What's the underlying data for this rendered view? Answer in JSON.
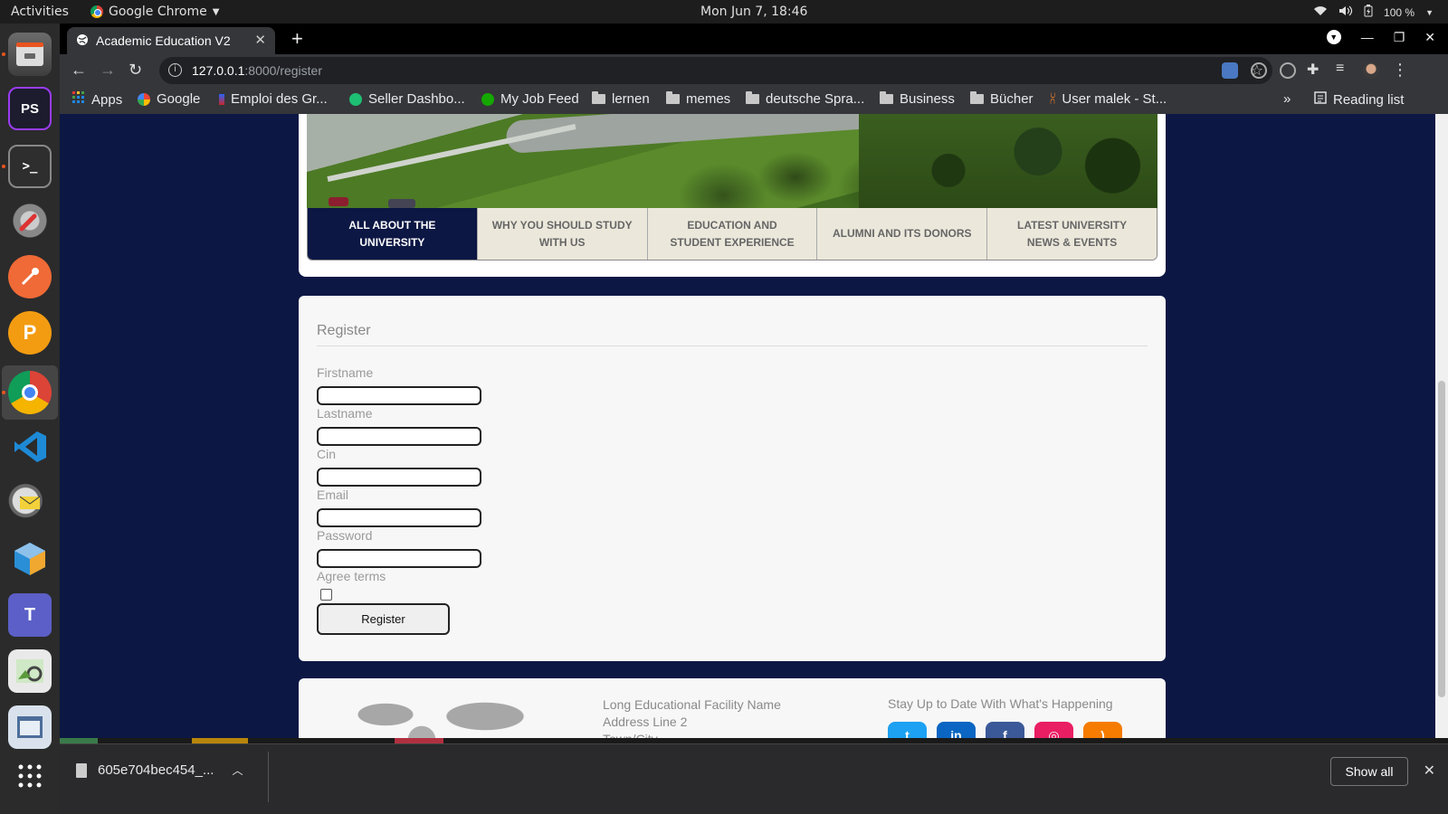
{
  "system": {
    "activities": "Activities",
    "app_name": "Google Chrome",
    "clock": "Mon Jun  7, 18:46",
    "battery": "100 %"
  },
  "browser": {
    "tab_title": "Academic Education V2",
    "url_host": "127.0.0.1",
    "url_path": ":8000/register",
    "bookmarks": [
      "Apps",
      "Google",
      "Emploi des Gr...",
      "Seller Dashbo...",
      "My Job Feed",
      "lernen",
      "memes",
      "deutsche Spra...",
      "Business",
      "Bücher",
      "User malek - St..."
    ],
    "reading_list": "Reading list",
    "overflow": "»"
  },
  "page": {
    "nav_tabs": [
      "ALL ABOUT THE UNIVERSITY",
      "WHY YOU SHOULD STUDY WITH US",
      "EDUCATION AND STUDENT EXPERIENCE",
      "ALUMNI AND ITS DONORS",
      "LATEST UNIVERSITY NEWS & EVENTS"
    ],
    "active_tab": 0,
    "register": {
      "title": "Register",
      "fields": [
        {
          "label": "Firstname",
          "value": ""
        },
        {
          "label": "Lastname",
          "value": ""
        },
        {
          "label": "Cin",
          "value": ""
        },
        {
          "label": "Email",
          "value": ""
        },
        {
          "label": "Password",
          "value": ""
        }
      ],
      "agree_label": "Agree terms",
      "agree_checked": false,
      "submit_label": "Register"
    },
    "footer": {
      "facility_name": "Long Educational Facility Name",
      "address_line_2": "Address Line 2",
      "town_city": "Town/City",
      "stay_updated": "Stay Up to Date With What's Happening",
      "social": [
        "twitter",
        "linkedin",
        "facebook",
        "instagram",
        "rss"
      ],
      "social_colors": [
        "#1da1f2",
        "#0a66c2",
        "#3b5998",
        "#e91e63",
        "#f57c00"
      ]
    }
  },
  "downloads": {
    "file_name": "605e704bec454_...",
    "show_all": "Show all"
  }
}
